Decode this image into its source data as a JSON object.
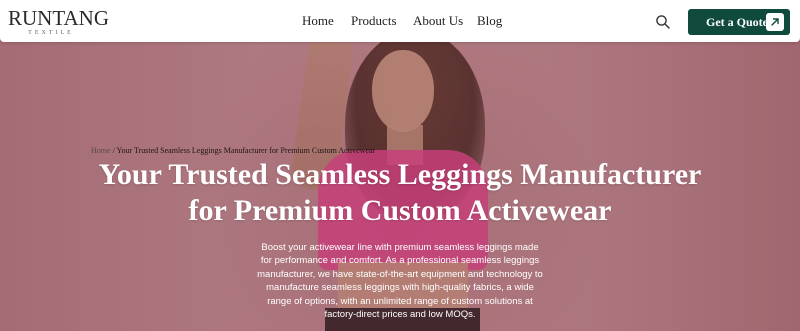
{
  "brand": {
    "name": "RUNTANG",
    "tagline": "TEXTILE"
  },
  "nav": {
    "home": "Home",
    "products": "Products",
    "about": "About Us",
    "blog": "Blog"
  },
  "header": {
    "search_icon": "search-icon",
    "quote_label": "Get a Quote",
    "quote_icon": "arrow-up-right-icon",
    "accent": "#0f4a3c"
  },
  "breadcrumb": {
    "home": "Home",
    "separator": " / ",
    "current": "Your Trusted Seamless Leggings Manufacturer for Premium Custom Activewear"
  },
  "hero": {
    "title_line1": "Your Trusted Seamless Leggings Manufacturer",
    "title_line2": "for Premium Custom Activewear",
    "description": "Boost your activewear line with premium seamless leggings made for performance and comfort. As a professional seamless leggings manufacturer, we have state-of-the-art equipment and technology to manufacture seamless leggings with high-quality fabrics, a wide range of options, with an unlimited range of custom solutions at factory-direct prices and low MOQs."
  }
}
